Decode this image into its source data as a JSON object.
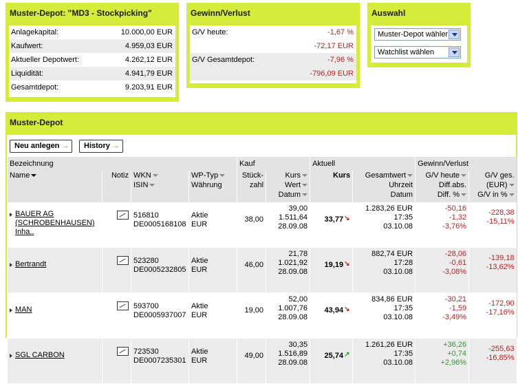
{
  "summary": {
    "title": "Muster-Depot: \"MD3 - Stockpicking\"",
    "rows": [
      {
        "label": "Anlagekapital:",
        "value": "10.000,00 EUR"
      },
      {
        "label": "Kaufwert:",
        "value": "4.959,03 EUR"
      },
      {
        "label": "Aktueller Depotwert:",
        "value": "4.262,12 EUR"
      },
      {
        "label": "Liquidität:",
        "value": "4.941,79 EUR"
      },
      {
        "label": "Gesamtdepot:",
        "value": "9.203,91 EUR"
      }
    ]
  },
  "gv": {
    "title": "Gewinn/Verlust",
    "heute_label": "G/V heute:",
    "heute_pct": "-1,67 %",
    "heute_eur": "-72,17 EUR",
    "gesamt_label": "G/V Gesamtdepot:",
    "gesamt_pct": "-7,96 %",
    "gesamt_eur": "-796,09 EUR"
  },
  "auswahl": {
    "title": "Auswahl",
    "select1": "Muster-Depot wähler",
    "select2": "Watchlist wählen"
  },
  "depot": {
    "title": "Muster-Depot",
    "btn_new": "Neu anlegen",
    "btn_history": "History",
    "groups": {
      "bezeichnung": "Bezeichnung",
      "kauf": "Kauf",
      "aktuell": "Aktuell",
      "gv": "Gewinn/Verlust"
    },
    "headers": {
      "name": "Name",
      "notiz": "Notiz",
      "wkn": "WKN",
      "isin": "ISIN",
      "wptyp": "WP-Typ",
      "waehrung": "Währung",
      "stueck1": "Stück-",
      "stueck2": "zahl",
      "kurs": "Kurs",
      "wert": "Wert",
      "datum": "Datum",
      "akt_kurs": "Kurs",
      "gesamtwert": "Gesamtwert",
      "uhrzeit": "Uhrzeit",
      "akt_datum": "Datum",
      "gv_heute": "G/V heute",
      "diff_abs": "Diff.abs.",
      "diff_pct": "Diff. %",
      "gv_ges": "G/V ges.",
      "gv_eur": "(EUR)",
      "gv_inpct": "G/V in %"
    },
    "rows": [
      {
        "name": "BAUER AG (SCHROBENHAUSEN) Inha..",
        "wkn": "516810",
        "isin": "DE0005168108",
        "typ": "Aktie",
        "cur": "EUR",
        "stueck": "38,00",
        "kauf_kurs": "39,00",
        "kauf_wert": "1.511,64",
        "kauf_datum": "28.09.08",
        "akt_kurs": "33,77",
        "trend": "down",
        "gesamtwert": "1.283,26 EUR",
        "uhrzeit": "17:35",
        "akt_datum": "03.10.08",
        "gv_heute": "-50,16",
        "diff_abs": "-1,32",
        "diff_pct": "-3,76%",
        "gv_ges": "-228,38",
        "gv_inpct": "-15,11%",
        "sign": "neg"
      },
      {
        "name": "Bertrandt",
        "wkn": "523280",
        "isin": "DE0005232805",
        "typ": "Aktie",
        "cur": "EUR",
        "stueck": "46,00",
        "kauf_kurs": "21,78",
        "kauf_wert": "1.021,92",
        "kauf_datum": "28.09.08",
        "akt_kurs": "19,19",
        "trend": "down",
        "gesamtwert": "882,74 EUR",
        "uhrzeit": "17:28",
        "akt_datum": "03.10.08",
        "gv_heute": "-28,06",
        "diff_abs": "-0,61",
        "diff_pct": "-3,08%",
        "gv_ges": "-139,18",
        "gv_inpct": "-13,62%",
        "sign": "neg"
      },
      {
        "name": "MAN",
        "wkn": "593700",
        "isin": "DE0005937007",
        "typ": "Aktie",
        "cur": "EUR",
        "stueck": "19,00",
        "kauf_kurs": "52,00",
        "kauf_wert": "1.007,76",
        "kauf_datum": "28.09.08",
        "akt_kurs": "43,94",
        "trend": "down",
        "gesamtwert": "834,86 EUR",
        "uhrzeit": "17:35",
        "akt_datum": "03.10.08",
        "gv_heute": "-30,21",
        "diff_abs": "-1,59",
        "diff_pct": "-3,49%",
        "gv_ges": "-172,90",
        "gv_inpct": "-17,16%",
        "sign": "neg"
      },
      {
        "name": "SGL CARBON",
        "wkn": "723530",
        "isin": "DE0007235301",
        "typ": "Aktie",
        "cur": "EUR",
        "stueck": "49,00",
        "kauf_kurs": "30,35",
        "kauf_wert": "1.516,89",
        "kauf_datum": "28.09.08",
        "akt_kurs": "25,74",
        "trend": "up",
        "gesamtwert": "1.261,26 EUR",
        "uhrzeit": "17:35",
        "akt_datum": "03.10.08",
        "gv_heute": "+36,26",
        "diff_abs": "+0,74",
        "diff_pct": "+2,96%",
        "gv_ges": "-255,63",
        "gv_inpct": "-16,85%",
        "sign": "pos"
      }
    ]
  }
}
